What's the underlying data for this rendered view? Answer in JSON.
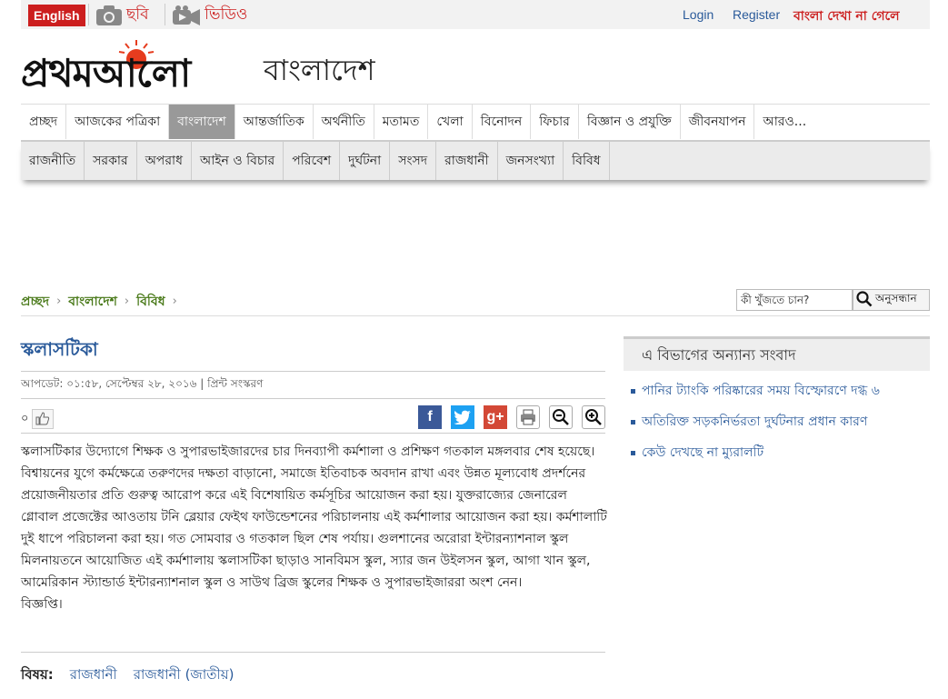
{
  "topbar": {
    "english_label": "English",
    "photo_label": "ছবি",
    "video_label": "ভিডিও",
    "login_label": "Login",
    "register_label": "Register",
    "font_help_label": "বাংলা দেখা না গেলে"
  },
  "brand": {
    "logo_text": "প্রথমআলো",
    "section_title": "বাংলাদেশ"
  },
  "nav": {
    "main": [
      "প্রচ্ছদ",
      "আজকের পত্রিকা",
      "বাংলাদেশ",
      "আন্তর্জাতিক",
      "অর্থনীতি",
      "মতামত",
      "খেলা",
      "বিনোদন",
      "ফিচার",
      "বিজ্ঞান ও প্রযুক্তি",
      "জীবনযাপন",
      "আরও..."
    ],
    "active_main": "বাংলাদেশ",
    "sub": [
      "রাজনীতি",
      "সরকার",
      "অপরাধ",
      "আইন ও বিচার",
      "পরিবেশ",
      "দুর্ঘটনা",
      "সংসদ",
      "রাজধানী",
      "জনসংখ্যা",
      "বিবিধ"
    ]
  },
  "breadcrumb": [
    "প্রচ্ছদ",
    "বাংলাদেশ",
    "বিবিধ"
  ],
  "search": {
    "placeholder": "কী খুঁজতে চান?",
    "button_label": "অনুসন্ধান"
  },
  "article": {
    "title": "স্কলাসটিকা",
    "meta": "আপডেট: ০১:৫৮, সেপ্টেম্বর ২৮, ২০১৬ | প্রিন্ট সংস্করণ",
    "like_count": "০",
    "body": [
      "স্কলাসটিকার উদ্যোগে শিক্ষক ও সুপারভাইজারদের চার দিনব্যাপী কর্মশালা ও প্রশিক্ষণ গতকাল মঙ্গলবার শেষ হয়েছে। বিশ্বায়নের যুগে কর্মক্ষেত্রে তরুণদের দক্ষতা বাড়ানো, সমাজে ইতিবাচক অবদান রাখা এবং উন্নত মূল্যবোধ প্রদর্শনের প্রয়োজনীয়তার প্রতি গুরুত্ব আরোপ করে এই বিশেষায়িত কর্মসূচির আয়োজন করা হয়। যুক্তরাজ্যের জেনারেল গ্লোবাল প্রজেক্টের আওতায় টনি ব্লেয়ার ফেইথ ফাউন্ডেশনের পরিচালনায় এই কর্মশালার আয়োজন করা হয়। কর্মশালাটি দুই ধাপে পরিচালনা করা হয়। গত সোমবার ও গতকাল ছিল শেষ পর্যায়। গুলশানের অরোরা ইন্টারন্যাশনাল স্কুল মিলনায়তনে আয়োজিত এই কর্মশালায় স্কলাসটিকা ছাড়াও সানবিমস স্কুল, স্যার জন উইলসন স্কুল, আগা খান স্কুল, আমেরিকান স্ট্যান্ডার্ড ইন্টারন্যাশনাল স্কুল ও সাউথ ব্রিজ স্কুলের শিক্ষক ও সুপারভাইজাররা অংশ নেন।",
      "বিজ্ঞপ্তি।"
    ],
    "topics_label": "বিষয়:",
    "topics": [
      "রাজধানী",
      "রাজধানী (জাতীয়)"
    ]
  },
  "sidebar": {
    "heading": "এ বিভাগের অন্যান্য সংবাদ",
    "items": [
      "পানির ট্যাংকি পরিষ্কারের সময় বিস্ফোরণে দগ্ধ ৬",
      "অতিরিক্ত সড়কনির্ভরতা দুর্ঘটনার প্রধান কারণ",
      "কেউ দেখছে না ম্যুরালটি"
    ]
  },
  "icons": {
    "camera": "camera-icon",
    "video": "video-camera-icon",
    "like": "thumbs-up-icon",
    "facebook": "facebook-icon",
    "twitter": "twitter-icon",
    "googleplus": "google-plus-icon",
    "print": "print-icon",
    "zoom_out": "zoom-out-icon",
    "zoom_in": "zoom-in-icon",
    "search": "search-icon"
  },
  "colors": {
    "brand_red": "#cc1f1f",
    "link_blue": "#2a5a9a",
    "breadcrumb_green": "#4a7a1a",
    "active_nav": "#999999"
  }
}
